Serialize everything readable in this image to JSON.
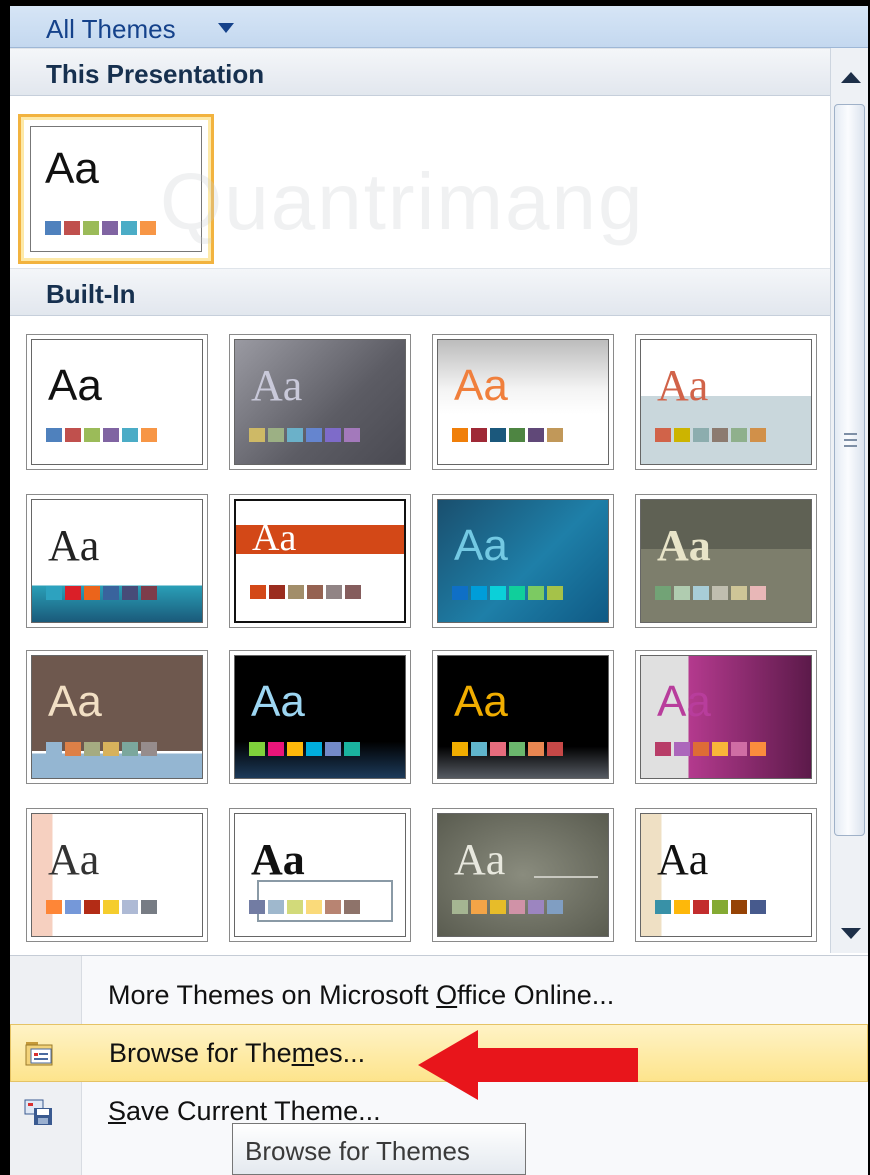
{
  "header": {
    "title": "All Themes"
  },
  "sections": {
    "this_presentation": "This Presentation",
    "built_in": "Built-In"
  },
  "watermark": "Quantrimang",
  "theme_sample_text": "Aa",
  "menu": {
    "more_themes": {
      "pre": "More Themes on Microsoft ",
      "ul": "O",
      "post": "ffice Online..."
    },
    "browse": {
      "pre": "Browse for The",
      "ul": "m",
      "post": "es..."
    },
    "save": {
      "ul": "S",
      "post": "ave Current Theme..."
    }
  },
  "tooltip": "Browse for Themes",
  "colors": {
    "accent_arrow": "#e8151b",
    "selected_border": "#f2b33f",
    "header_text": "#15428b"
  }
}
